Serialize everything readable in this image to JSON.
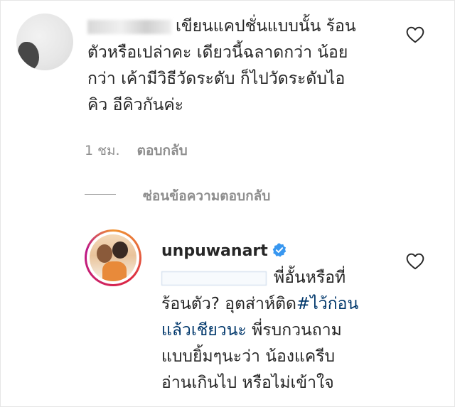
{
  "comment1": {
    "text_line1": "เขียนแคปชั่นแบบนั้น ร้อน",
    "text_line2": "ตัวหรือเปล่าคะ เดียวนี้ฉลาดกว่า น้อย",
    "text_line3": "กว่า เค้ามีวิธีวัดระดับ ก็ไปวัดระดับไอ",
    "text_line4": "คิว อีคิวกันค่ะ",
    "time": "1 ชม.",
    "reply_label": "ตอบกลับ"
  },
  "hide_replies_label": "ซ่อนข้อความตอบกลับ",
  "reply": {
    "username": "unpuwanart",
    "text_line1_end": "พี่อั้นหรือที่",
    "text_line2_start": "ร้อนตัว? อุตส่าห์ติด",
    "hashtag_part1": "#ไว้ก่อน",
    "hashtag_part2": "แล้วเชียวนะ",
    "text_line3_end": " พี่รบกวนถาม",
    "text_line4": "แบบยิ้มๆนะว่า น้องแครีบ",
    "text_line5": "อ่านเกินไป หรือไม่เข้าใจ"
  },
  "colors": {
    "text": "#262626",
    "meta": "#8e8e8e",
    "hashtag": "#00376b",
    "verified": "#3897f0"
  },
  "icons": [
    "heart-outline-icon",
    "verified-badge-icon"
  ]
}
